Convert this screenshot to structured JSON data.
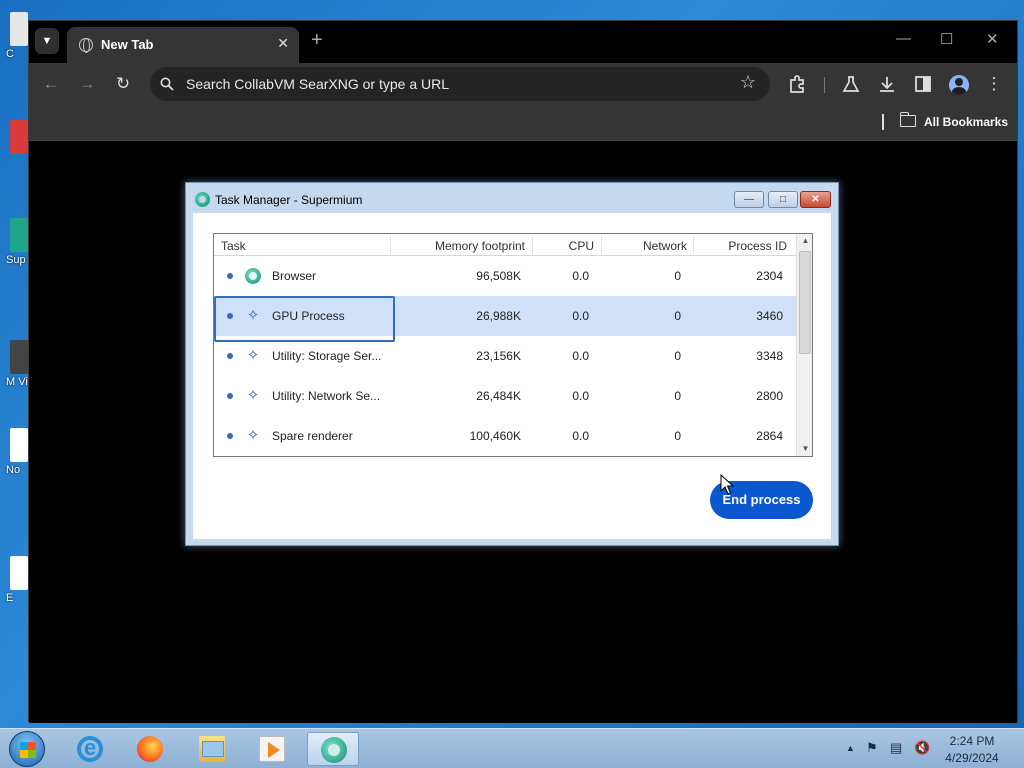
{
  "desktop": {
    "icons": [
      {
        "label": "C",
        "icon": "app-icon",
        "color": "#e6e6e6"
      },
      {
        "label": "",
        "icon": "app-icon",
        "color": "#d93a3a"
      },
      {
        "label": "Sup",
        "icon": "supermium-icon",
        "color": "#20a488"
      },
      {
        "label": "M\nVis",
        "icon": "app-icon",
        "color": "#444444"
      },
      {
        "label": "No",
        "icon": "notepad-icon",
        "color": "#ffffff"
      },
      {
        "label": "E",
        "icon": "app-icon",
        "color": "#ffffff"
      }
    ]
  },
  "browser": {
    "tab": {
      "title": "New Tab",
      "icon": "globe-icon"
    },
    "omnibox": {
      "placeholder": "Search CollabVM SearXNG or type a URL"
    },
    "bookmarks": {
      "all_bookmarks_label": "All Bookmarks"
    }
  },
  "task_manager": {
    "title": "Task Manager - Supermium",
    "columns": [
      "Task",
      "Memory footprint",
      "CPU",
      "Network",
      "Process ID"
    ],
    "rows": [
      {
        "task": "Browser",
        "icon": "supermium-icon",
        "memory": "96,508K",
        "cpu": "0.0",
        "network": "0",
        "pid": "2304",
        "selected": false
      },
      {
        "task": "GPU Process",
        "icon": "puzzle-icon",
        "memory": "26,988K",
        "cpu": "0.0",
        "network": "0",
        "pid": "3460",
        "selected": true
      },
      {
        "task": "Utility: Storage Ser...",
        "icon": "puzzle-icon",
        "memory": "23,156K",
        "cpu": "0.0",
        "network": "0",
        "pid": "3348",
        "selected": false
      },
      {
        "task": "Utility: Network Se...",
        "icon": "puzzle-icon",
        "memory": "26,484K",
        "cpu": "0.0",
        "network": "0",
        "pid": "2800",
        "selected": false
      },
      {
        "task": "Spare renderer",
        "icon": "puzzle-icon",
        "memory": "100,460K",
        "cpu": "0.0",
        "network": "0",
        "pid": "2864",
        "selected": false
      }
    ],
    "end_process_label": "End process",
    "accent": "#0b57d0"
  },
  "taskbar": {
    "clock_time": "2:24 PM",
    "clock_date": "4/29/2024"
  }
}
